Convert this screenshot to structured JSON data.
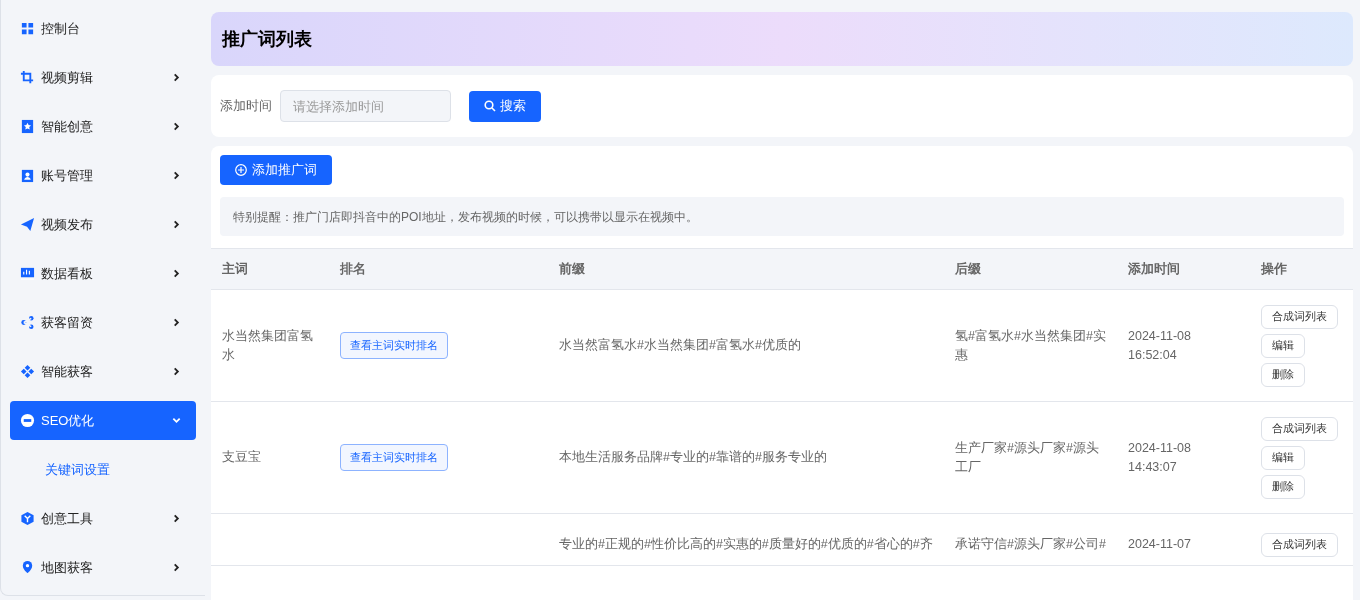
{
  "sidebar": {
    "items": [
      {
        "kind": "link",
        "label": "控制台",
        "selected": false
      },
      {
        "kind": "group",
        "label": "视频剪辑",
        "selected": false,
        "expanded": false
      },
      {
        "kind": "group",
        "label": "智能创意",
        "selected": false,
        "expanded": false
      },
      {
        "kind": "group",
        "label": "账号管理",
        "selected": false,
        "expanded": false
      },
      {
        "kind": "group",
        "label": "视频发布",
        "selected": false,
        "expanded": false
      },
      {
        "kind": "group",
        "label": "数据看板",
        "selected": false,
        "expanded": false
      },
      {
        "kind": "group",
        "label": "获客留资",
        "selected": false,
        "expanded": false
      },
      {
        "kind": "group",
        "label": "智能获客",
        "selected": false,
        "expanded": false
      },
      {
        "kind": "group",
        "label": "SEO优化",
        "selected": true,
        "expanded": true,
        "children": [
          {
            "label": "关键词设置",
            "selected": true
          }
        ]
      },
      {
        "kind": "group",
        "label": "创意工具",
        "selected": false,
        "expanded": false
      },
      {
        "kind": "group",
        "label": "地图获客",
        "selected": false,
        "expanded": false
      }
    ]
  },
  "page_title": "推广词列表",
  "filter": {
    "label": "添加时间",
    "placeholder": "请选择添加时间",
    "search_button": "搜索"
  },
  "add_button": "添加推广词",
  "notice": "特别提醒：推广门店即抖音中的POI地址，发布视频的时候，可以携带以显示在视频中。",
  "table": {
    "columns": [
      "主词",
      "排名",
      "前缀",
      "后缀",
      "添加时间",
      "操作"
    ],
    "rows": [
      {
        "main_word": "水当然集团富氢水",
        "rank_button": "查看主词实时排名",
        "prefix": "水当然富氢水#水当然集团#富氢水#优质的",
        "suffix": "氢#富氢水#水当然集团#实惠",
        "added": "2024-11-08 16:52:04",
        "actions": [
          "合成词列表",
          "编辑",
          "删除"
        ]
      },
      {
        "main_word": "支豆宝",
        "rank_button": "查看主词实时排名",
        "prefix": "本地生活服务品牌#专业的#靠谱的#服务专业的",
        "suffix": "生产厂家#源头厂家#源头工厂",
        "added": "2024-11-08 14:43:07",
        "actions": [
          "合成词列表",
          "编辑",
          "删除"
        ]
      },
      {
        "prefix": "专业的#正规的#性价比高的#实惠的#质量好的#优质的#省心的#齐",
        "suffix": "承诺守信#源头厂家#公司#",
        "added": "2024-11-07",
        "actions": [
          "合成词列表"
        ]
      }
    ]
  }
}
